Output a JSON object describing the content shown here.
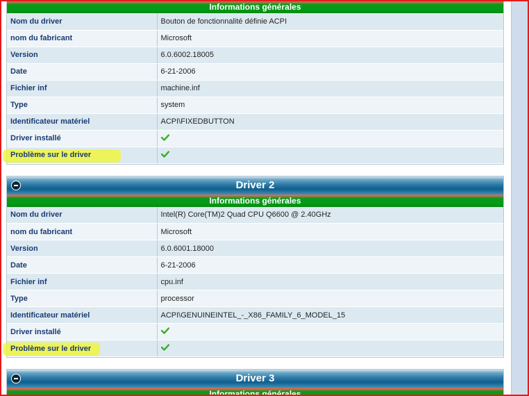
{
  "section_title": "Informations générales",
  "drivers": [
    {
      "title": "",
      "rows": [
        {
          "label": "Nom du driver",
          "value": "Bouton de fonctionnalité définie ACPI"
        },
        {
          "label": "nom du fabricant",
          "value": "Microsoft"
        },
        {
          "label": "Version",
          "value": "6.0.6002.18005"
        },
        {
          "label": "Date",
          "value": "6-21-2006"
        },
        {
          "label": "Fichier inf",
          "value": "machine.inf"
        },
        {
          "label": "Type",
          "value": "system"
        },
        {
          "label": "Identificateur matériel",
          "value": "ACPI\\FIXEDBUTTON"
        },
        {
          "label": "Driver installé",
          "value": "check"
        },
        {
          "label": "Problème sur le driver",
          "value": "check"
        }
      ]
    },
    {
      "title": "Driver 2",
      "rows": [
        {
          "label": "Nom du driver",
          "value": "Intel(R) Core(TM)2 Quad CPU Q6600 @ 2.40GHz"
        },
        {
          "label": "nom du fabricant",
          "value": "Microsoft"
        },
        {
          "label": "Version",
          "value": "6.0.6001.18000"
        },
        {
          "label": "Date",
          "value": "6-21-2006"
        },
        {
          "label": "Fichier inf",
          "value": "cpu.inf"
        },
        {
          "label": "Type",
          "value": "processor"
        },
        {
          "label": "Identificateur matériel",
          "value": "ACPI\\GENUINEINTEL_-_X86_FAMILY_6_MODEL_15"
        },
        {
          "label": "Driver installé",
          "value": "check"
        },
        {
          "label": "Problème sur le driver",
          "value": "check"
        }
      ]
    },
    {
      "title": "Driver 3",
      "rows": []
    }
  ],
  "colors": {
    "frame": "#e21b1b",
    "header_blue": "#0f5f8e",
    "section_green": "#029b16",
    "label_blue": "#1a3b73",
    "check_green": "#3cae2c",
    "highlight_yellow": "#f0f628"
  },
  "icons": {
    "collapse": "minus-circle-icon",
    "check": "check-icon"
  }
}
